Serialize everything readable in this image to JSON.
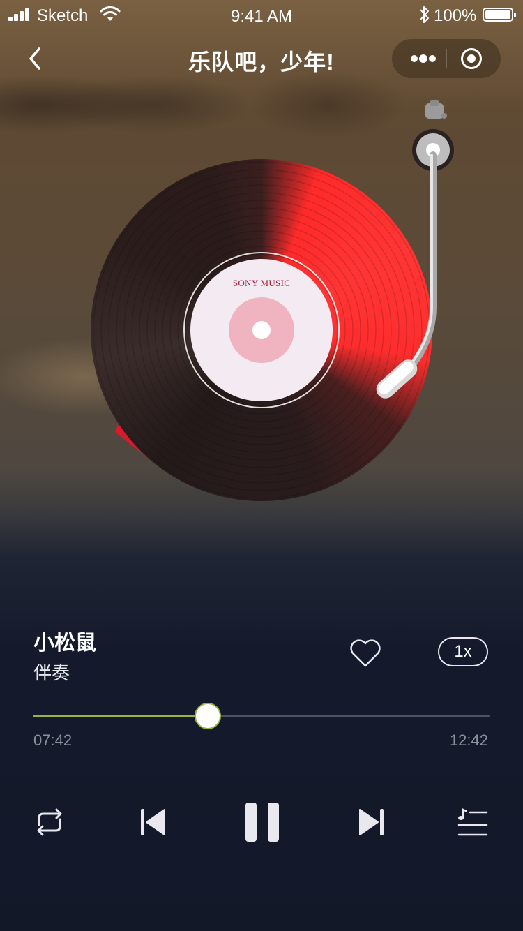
{
  "status_bar": {
    "carrier": "Sketch",
    "time": "9:41 AM",
    "battery": "100%"
  },
  "nav": {
    "title": "乐队吧，少年!"
  },
  "record": {
    "label_text": "SONY MUSIC"
  },
  "song": {
    "title": "小松鼠",
    "subtitle": "伴奏",
    "speed": "1x"
  },
  "progress": {
    "current": "07:42",
    "total": "12:42",
    "fraction": 0.382
  },
  "icons": {
    "back": "chevron-left-icon",
    "more": "more-dots-icon",
    "close": "target-icon",
    "favorite": "heart-icon",
    "repeat": "repeat-icon",
    "previous": "skip-previous-icon",
    "pause": "pause-icon",
    "next": "skip-next-icon",
    "playlist": "playlist-icon"
  },
  "colors": {
    "accent": "#9ab43a",
    "record_red": "#ff2d2d",
    "background": "#131829"
  }
}
